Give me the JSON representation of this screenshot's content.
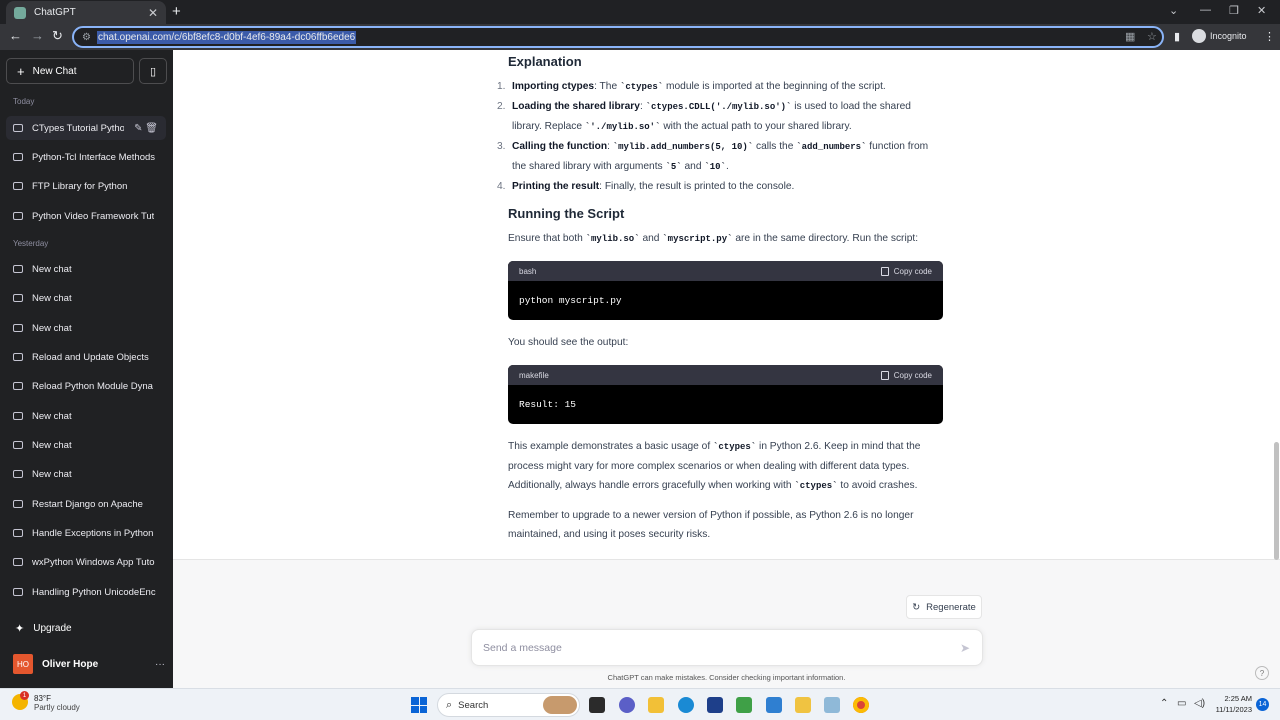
{
  "browser": {
    "tab_title": "ChatGPT",
    "url": "chat.openai.com/c/6bf8efc8-d0bf-4ef6-89a4-dc06ffb6ede6",
    "incognito_label": "Incognito"
  },
  "sidebar": {
    "new_chat_label": "New Chat",
    "sections": [
      {
        "label": "Today",
        "items": [
          "CTypes Tutorial Pytho",
          "Python-Tcl Interface Methods",
          "FTP Library for Python",
          "Python Video Framework Tut"
        ]
      },
      {
        "label": "Yesterday",
        "items": [
          "New chat",
          "New chat",
          "New chat",
          "Reload and Update Objects",
          "Reload Python Module Dyna",
          "New chat",
          "New chat",
          "New chat",
          "Restart Django on Apache",
          "Handle Exceptions in Python",
          "wxPython Windows App Tuto",
          "Handling Python UnicodeEnc"
        ]
      }
    ],
    "upgrade_label": "Upgrade",
    "user": {
      "initials": "HO",
      "name": "Oliver Hope"
    }
  },
  "main": {
    "explanation_heading": "Explanation",
    "steps": [
      {
        "num": "1.",
        "title": "Importing ctypes",
        "p1": ": The ",
        "c1": "`ctypes`",
        "p2": " module is imported at the beginning of the script.",
        "line2": ""
      },
      {
        "num": "2.",
        "title": "Loading the shared library",
        "p1": ": ",
        "c1": "`ctypes.CDLL('./mylib.so')`",
        "p2": " is used to load the shared",
        "line2a": "library. Replace ",
        "line2c": "`'./mylib.so'`",
        "line2b": " with the actual path to your shared library."
      },
      {
        "num": "3.",
        "title": "Calling the function",
        "p1": ": ",
        "c1": "`mylib.add_numbers(5, 10)`",
        "p2": " calls the ",
        "c2": "`add_numbers`",
        "p3": " function from",
        "line2a": "the shared library with arguments ",
        "line2c": "`5`",
        "line2m": " and ",
        "line2d": "`10`",
        "line2b": "."
      },
      {
        "num": "4.",
        "title": "Printing the result",
        "p1": ": Finally, the result is printed to the console."
      }
    ],
    "running_heading": "Running the Script",
    "running_p1": "Ensure that both ",
    "running_c1": "`mylib.so`",
    "running_p2": " and ",
    "running_c2": "`myscript.py`",
    "running_p3": " are in the same directory. Run the script:",
    "code1": {
      "lang": "bash",
      "copy": "Copy code",
      "code": "python myscript.py"
    },
    "output_text": "You should see the output:",
    "code2": {
      "lang": "makefile",
      "copy": "Copy code",
      "code": "Result: 15"
    },
    "summary_a": "This example demonstrates a basic usage of ",
    "summary_c1": "`ctypes`",
    "summary_b": " in Python 2.6. Keep in mind that the",
    "summary_line2": "process might vary for more complex scenarios or when dealing with different data types.",
    "summary_line3a": "Additionally, always handle errors gracefully when working with ",
    "summary_c2": "`ctypes`",
    "summary_line3b": " to avoid crashes.",
    "remember_line1": "Remember to upgrade to a newer version of Python if possible, as Python 2.6 is no longer",
    "remember_line2": "maintained, and using it poses security risks.",
    "regenerate_label": "Regenerate",
    "input_placeholder": "Send a message",
    "disclaimer": "ChatGPT can make mistakes. Consider checking important information.",
    "help": "?"
  },
  "taskbar": {
    "temp": "83°F",
    "weather": "Partly cloudy",
    "weather_badge": "1",
    "search_label": "Search",
    "time": "2:25 AM",
    "date": "11/11/2023",
    "notifications": "14"
  }
}
